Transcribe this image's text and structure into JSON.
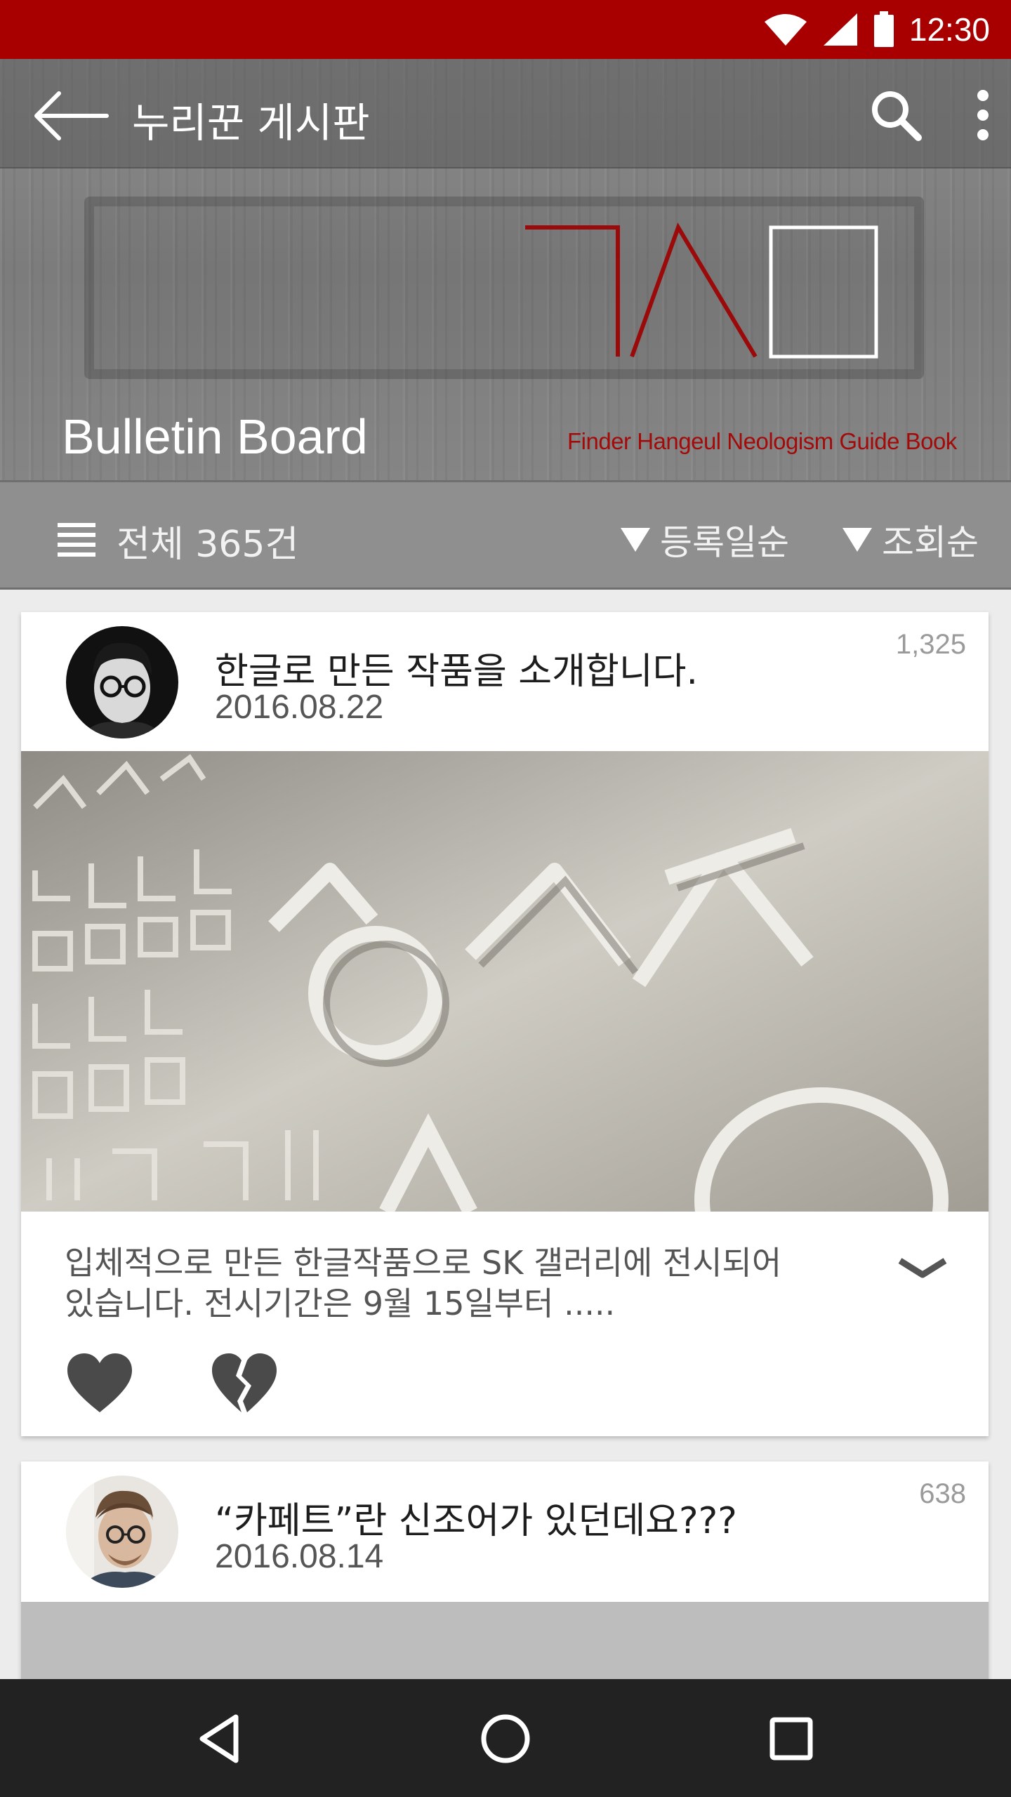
{
  "status_bar": {
    "time": "12:30",
    "icons": [
      "wifi-icon",
      "signal-icon",
      "battery-icon"
    ]
  },
  "toolbar": {
    "title": "누리꾼 게시판",
    "icons": [
      "back-arrow-icon",
      "search-icon",
      "more-vert-icon"
    ]
  },
  "banner": {
    "title": "Bulletin Board",
    "subtitle": "Finder Hangeul Neologism Guide Book"
  },
  "filter_bar": {
    "total_label": "전체 365건",
    "sort_options": [
      "등록일순",
      "조회순"
    ]
  },
  "posts": [
    {
      "title": "한글로 만든 작품을 소개합니다.",
      "date": "2016.08.22",
      "views": "1,325",
      "excerpt_line1": "입체적으로 만든 한글작품으로 SK 갤러리에 전시되어",
      "excerpt_line2": "있습니다. 전시기간은 9월 15일부터 .....",
      "actions": [
        "heart-icon",
        "broken-heart-icon",
        "chevron-down-icon"
      ]
    },
    {
      "title": "“카페트”란 신조어가 있던데요???",
      "date": "2016.08.14",
      "views": "638"
    }
  ],
  "nav_bar": {
    "buttons": [
      "back-triangle-icon",
      "home-circle-icon",
      "recents-square-icon"
    ]
  },
  "colors": {
    "status_bar": "#a80000",
    "brand_red": "#a30b0b",
    "nav_bar": "#222222"
  }
}
